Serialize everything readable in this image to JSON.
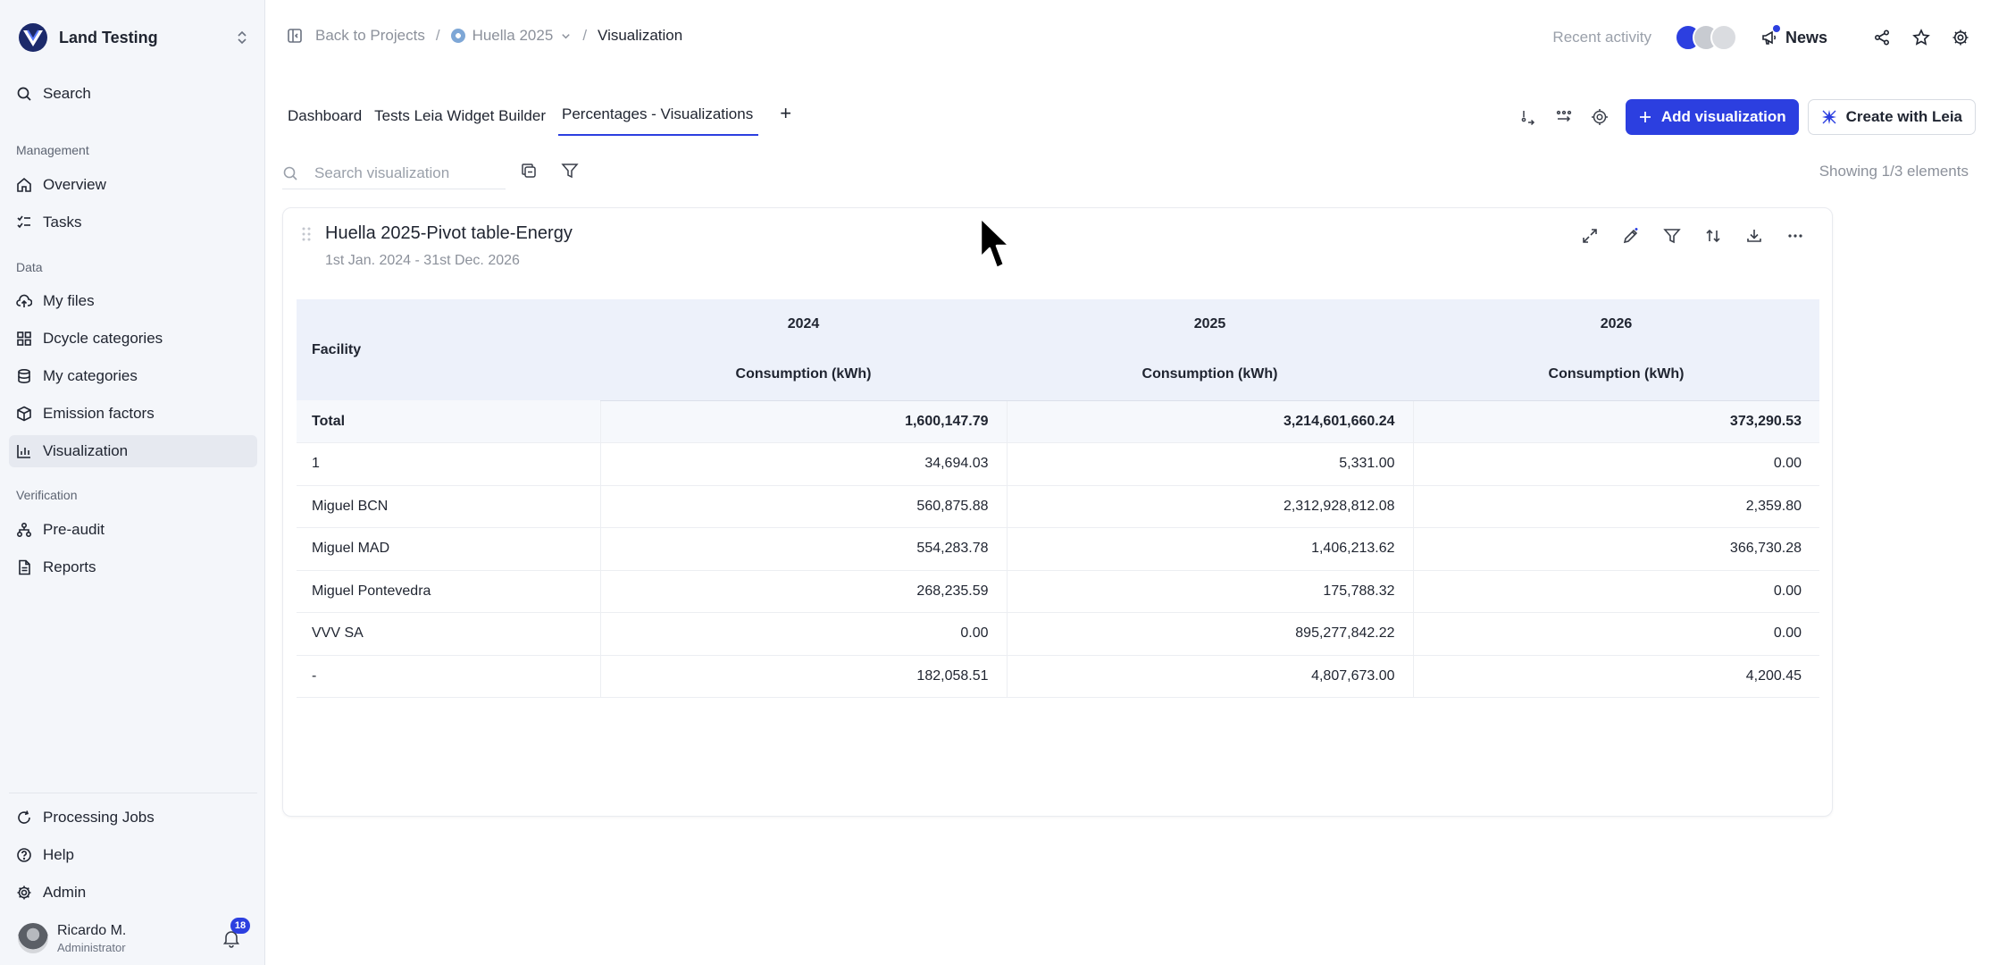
{
  "sidebar": {
    "org_name": "Land Testing",
    "search_label": "Search",
    "sections": {
      "management": "Management",
      "data": "Data",
      "verification": "Verification"
    },
    "items": {
      "overview": "Overview",
      "tasks": "Tasks",
      "my_files": "My files",
      "dcycle_categories": "Dcycle categories",
      "my_categories": "My categories",
      "emission_factors": "Emission factors",
      "visualization": "Visualization",
      "pre_audit": "Pre-audit",
      "reports": "Reports",
      "processing_jobs": "Processing Jobs",
      "help": "Help",
      "admin": "Admin"
    },
    "user": {
      "name": "Ricardo M.",
      "role": "Administrator",
      "notifications": "18"
    }
  },
  "header": {
    "back_label": "Back to Projects",
    "project_label": "Huella 2025",
    "current_label": "Visualization",
    "recent_activity": "Recent activity",
    "news_label": "News"
  },
  "tabs": [
    "Dashboard",
    "Tests Leia Widget Builder",
    "Percentages - Visualizations"
  ],
  "active_tab_index": 2,
  "toolbar": {
    "add_visualization": "Add visualization",
    "create_with_leia": "Create with Leia"
  },
  "search": {
    "placeholder": "Search visualization",
    "showing": "Showing 1/3 elements"
  },
  "card": {
    "title": "Huella 2025-Pivot table-Energy",
    "date_range": "1st Jan. 2024 - 31st Dec. 2026",
    "table": {
      "row_header": "Facility",
      "years": [
        "2024",
        "2025",
        "2026"
      ],
      "measure": "Consumption (kWh)",
      "rows": [
        {
          "name": "Total",
          "values": [
            "1,600,147.79",
            "3,214,601,660.24",
            "373,290.53"
          ]
        },
        {
          "name": "1",
          "values": [
            "34,694.03",
            "5,331.00",
            "0.00"
          ]
        },
        {
          "name": "Miguel BCN",
          "values": [
            "560,875.88",
            "2,312,928,812.08",
            "2,359.80"
          ]
        },
        {
          "name": "Miguel MAD",
          "values": [
            "554,283.78",
            "1,406,213.62",
            "366,730.28"
          ]
        },
        {
          "name": "Miguel Pontevedra",
          "values": [
            "268,235.59",
            "175,788.32",
            "0.00"
          ]
        },
        {
          "name": "VVV SA",
          "values": [
            "0.00",
            "895,277,842.22",
            "0.00"
          ]
        },
        {
          "name": "-",
          "values": [
            "182,058.51",
            "4,807,673.00",
            "4,200.45"
          ]
        }
      ]
    }
  },
  "colors": {
    "accent": "#2c3fe0",
    "sidebar_bg": "#f4f6fa",
    "table_header_bg": "#edf1fa"
  }
}
